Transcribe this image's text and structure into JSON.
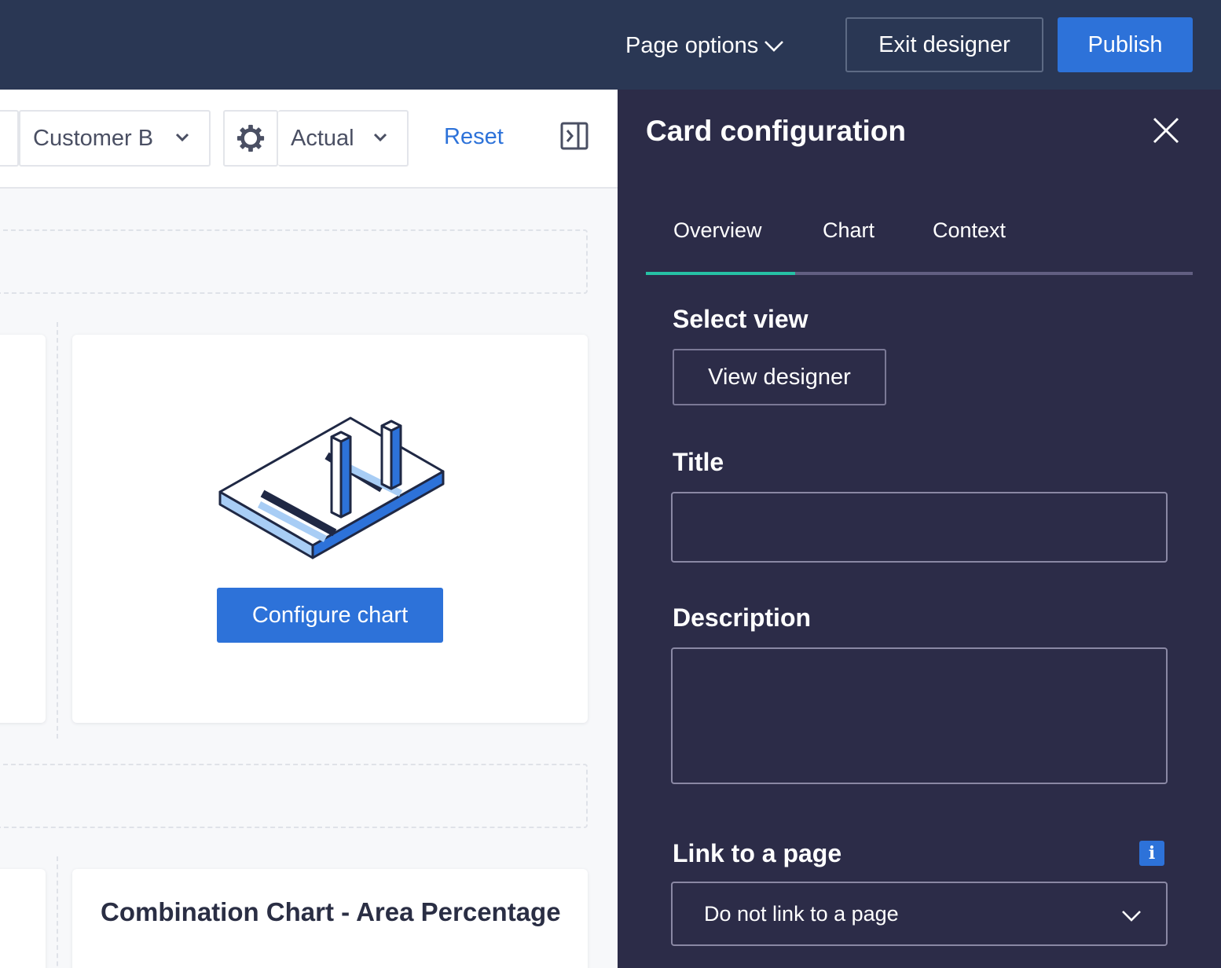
{
  "topbar": {
    "page_options_label": "Page options",
    "exit_designer_label": "Exit designer",
    "publish_label": "Publish"
  },
  "filters": {
    "customer_label": "Customer B",
    "scenario_label": "Actual",
    "reset_label": "Reset"
  },
  "cards": {
    "placeholder_button_label": "Configure chart",
    "second_card_title": "Combination Chart - Area Percentage"
  },
  "panel": {
    "title": "Card configuration",
    "tabs": [
      {
        "label": "Overview",
        "active": true
      },
      {
        "label": "Chart",
        "active": false
      },
      {
        "label": "Context",
        "active": false
      }
    ],
    "select_view_label": "Select view",
    "view_designer_label": "View designer",
    "title_label": "Title",
    "title_value": "",
    "description_label": "Description",
    "description_value": "",
    "link_label": "Link to a page",
    "link_value": "Do not link to a page"
  },
  "colors": {
    "topbar_bg": "#2a3754",
    "panel_bg": "#2c2c48",
    "accent_blue": "#2d72d9",
    "tab_active": "#26c1a5"
  },
  "icons": [
    "chevron-down-icon",
    "gear-icon",
    "panel-collapse-icon",
    "close-icon",
    "info-icon",
    "chart-illustration"
  ]
}
